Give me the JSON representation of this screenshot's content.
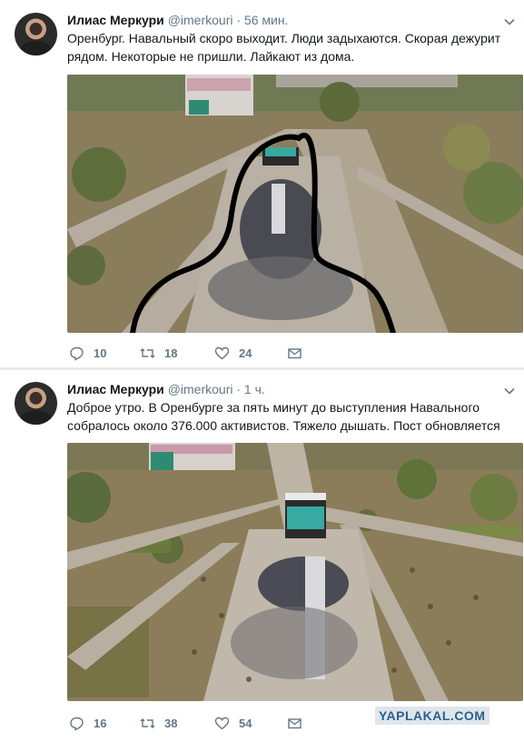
{
  "tweets": [
    {
      "author": "Илиас Меркури",
      "handle": "@imerkouri",
      "dot": "·",
      "time": "56 мин.",
      "text": "Оренбург. Навальный скоро выходит. Люди задыхаются. Скорая дежурит рядом. Некоторые не пришли. Лайкают из дома.",
      "replies": "10",
      "retweets": "18",
      "likes": "24"
    },
    {
      "author": "Илиас Меркури",
      "handle": "@imerkouri",
      "dot": "·",
      "time": "1 ч.",
      "text": "Доброе утро. В Оренбурге за пять минут до выступления Навального собралось около 376.000 активистов. Тяжело дышать. Пост обновляется",
      "replies": "16",
      "retweets": "38",
      "likes": "54"
    }
  ],
  "icons": {
    "reply": "reply-icon",
    "retweet": "retweet-icon",
    "like": "heart-icon",
    "message": "envelope-icon",
    "menu": "chevron-down-icon"
  },
  "watermark": "YAPLAKAL.COM",
  "colors": {
    "icon_gray": "#657786",
    "background": "#e6ecf0",
    "watermark": "#2b5f8f"
  }
}
